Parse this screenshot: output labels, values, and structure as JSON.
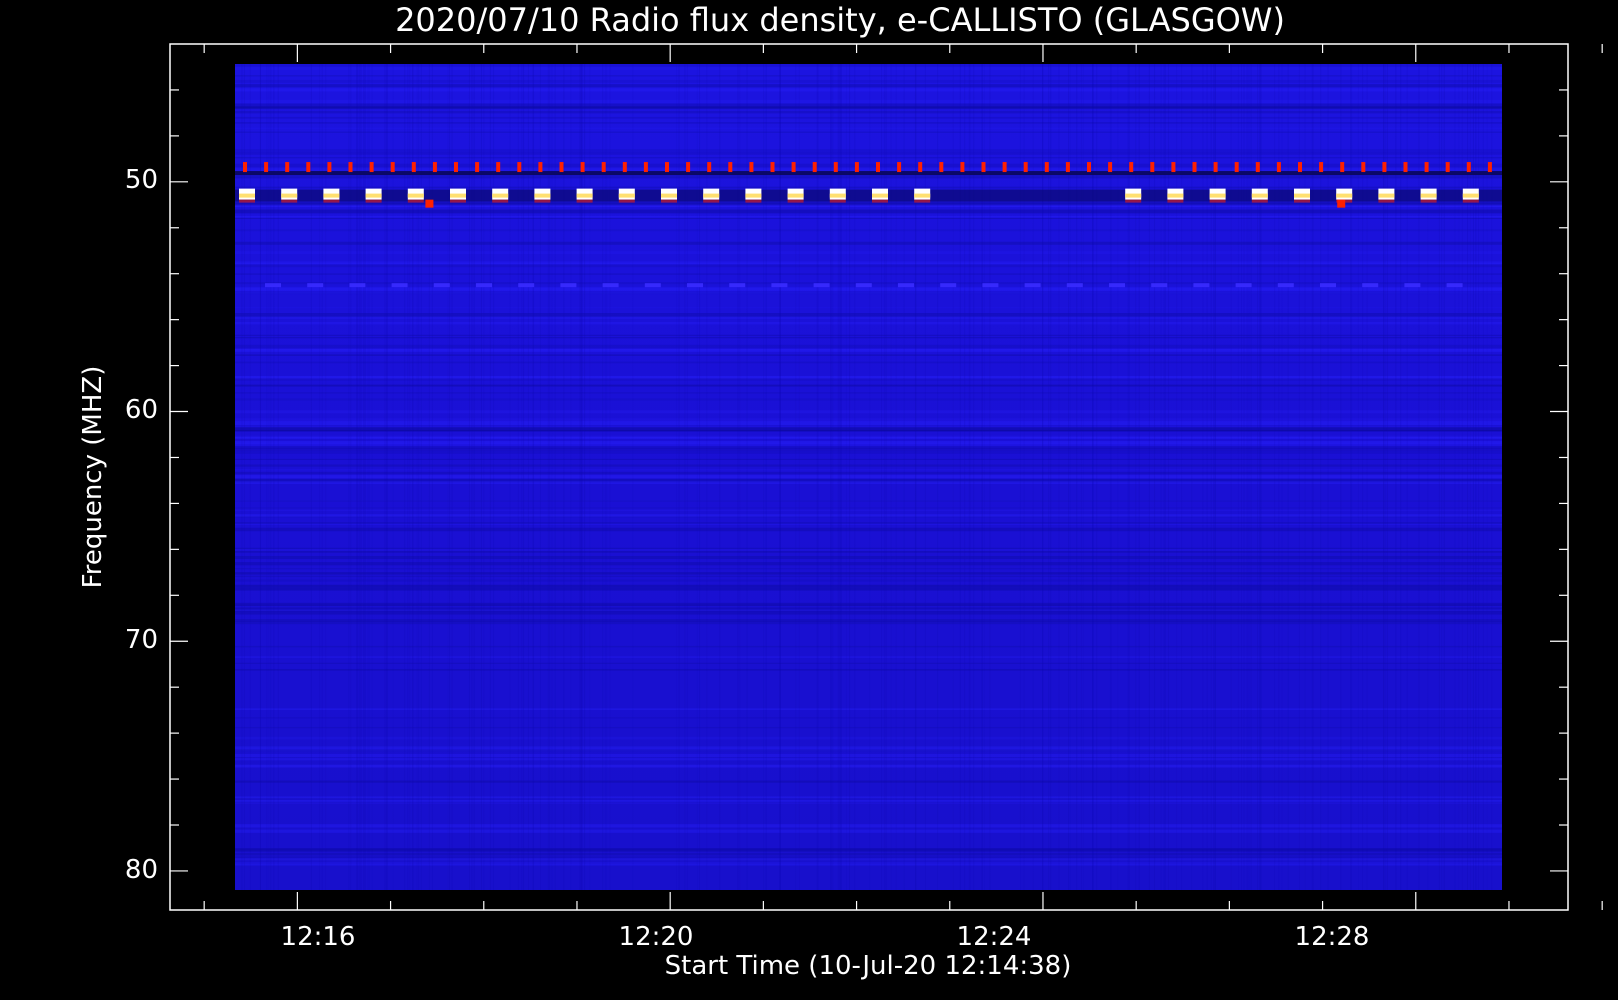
{
  "chart_data": {
    "type": "heatmap",
    "title": "2020/07/10  Radio flux density, e-CALLISTO (GLASGOW)",
    "xlabel": "Start Time (10-Jul-20 12:14:38)",
    "ylabel": "Frequency (MHZ)",
    "x_axis": {
      "type": "time",
      "range": [
        "12:14:38",
        "12:29:38"
      ],
      "data_range": [
        "12:15:00",
        "12:30:00"
      ],
      "tick_labels": [
        "12:16",
        "12:20",
        "12:24",
        "12:28"
      ]
    },
    "y_axis": {
      "unit": "MHz",
      "range": [
        44.0,
        81.7
      ],
      "data_range": [
        45.0,
        81.0
      ],
      "inverted": true,
      "tick_labels": [
        "50",
        "60",
        "70",
        "80"
      ]
    },
    "background_intensity": "low",
    "colors": {
      "background": "#000000",
      "axis": "#ffffff",
      "low": "#1a10d8",
      "mid": "#ff2000",
      "high": "#ffffff",
      "band": "#ffe070"
    },
    "bands": [
      {
        "freq_mhz": 49.4,
        "intensity": "moderate",
        "pattern": "periodic"
      },
      {
        "freq_mhz": 50.6,
        "intensity": "strong",
        "pattern": "periodic"
      },
      {
        "freq_mhz": 54.5,
        "intensity": "weak",
        "pattern": "periodic"
      }
    ]
  }
}
